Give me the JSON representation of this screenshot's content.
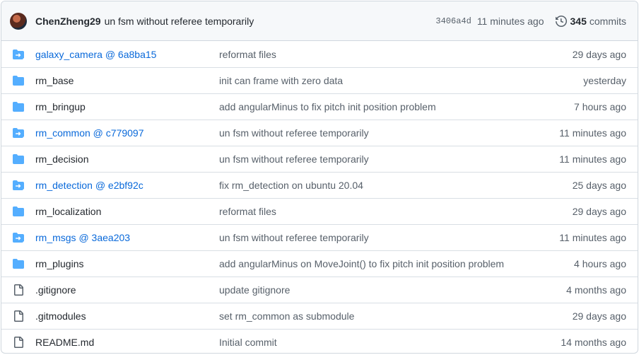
{
  "header": {
    "author": "ChenZheng29",
    "message": "un fsm without referee temporarily",
    "sha": "3406a4d",
    "time": "11 minutes ago",
    "commit_count": "345",
    "commit_label": "commits"
  },
  "rows": [
    {
      "type": "submodule",
      "icon": "submodule-folder-icon",
      "name": "galaxy_camera @ 6a8ba15",
      "message": "reformat files",
      "time": "29 days ago"
    },
    {
      "type": "dir",
      "icon": "folder-icon",
      "name": "rm_base",
      "message": "init can frame with zero data",
      "time": "yesterday"
    },
    {
      "type": "dir",
      "icon": "folder-icon",
      "name": "rm_bringup",
      "message": "add angularMinus to fix pitch init position problem",
      "time": "7 hours ago"
    },
    {
      "type": "submodule",
      "icon": "submodule-folder-icon",
      "name": "rm_common @ c779097",
      "message": "un fsm without referee temporarily",
      "time": "11 minutes ago"
    },
    {
      "type": "dir",
      "icon": "folder-icon",
      "name": "rm_decision",
      "message": "un fsm without referee temporarily",
      "time": "11 minutes ago"
    },
    {
      "type": "submodule",
      "icon": "submodule-folder-icon",
      "name": "rm_detection @ e2bf92c",
      "message": "fix rm_detection on ubuntu 20.04",
      "time": "25 days ago"
    },
    {
      "type": "dir",
      "icon": "folder-icon",
      "name": "rm_localization",
      "message": "reformat files",
      "time": "29 days ago"
    },
    {
      "type": "submodule",
      "icon": "submodule-folder-icon",
      "name": "rm_msgs @ 3aea203",
      "message": "un fsm without referee temporarily",
      "time": "11 minutes ago"
    },
    {
      "type": "dir",
      "icon": "folder-icon",
      "name": "rm_plugins",
      "message": "add angularMinus on MoveJoint() to fix pitch init position problem",
      "time": "4 hours ago"
    },
    {
      "type": "file",
      "icon": "file-icon",
      "name": ".gitignore",
      "message": "update gitignore",
      "time": "4 months ago"
    },
    {
      "type": "file",
      "icon": "file-icon",
      "name": ".gitmodules",
      "message": "set rm_common as submodule",
      "time": "29 days ago"
    },
    {
      "type": "file",
      "icon": "file-icon",
      "name": "README.md",
      "message": "Initial commit",
      "time": "14 months ago"
    }
  ],
  "colors": {
    "folder": "#54aeff",
    "link": "#0969da",
    "muted": "#57606a",
    "header_bg": "#f6f8fa"
  }
}
